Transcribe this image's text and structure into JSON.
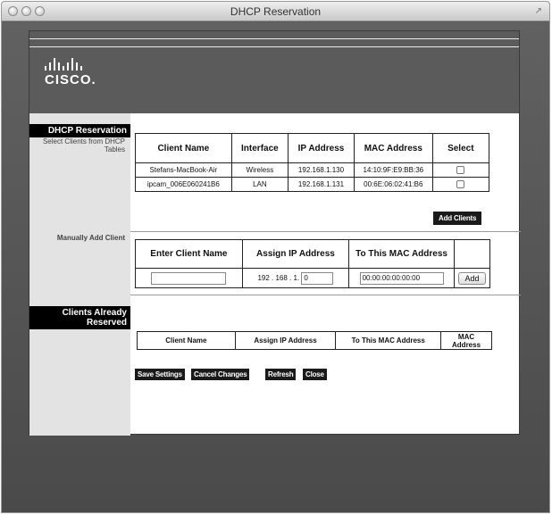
{
  "window": {
    "title": "DHCP Reservation"
  },
  "brand": {
    "logo_text": "CISCO."
  },
  "sections": {
    "dhcp_reservation": "DHCP Reservation",
    "select_clients_label": "Select Clients from DHCP Tables",
    "manually_add_label": "Manually Add Client",
    "clients_reserved": "Clients Already Reserved"
  },
  "clients_table": {
    "headers": [
      "Client Name",
      "Interface",
      "IP Address",
      "MAC Address",
      "Select"
    ],
    "rows": [
      {
        "name": "Stefans-MacBook-Air",
        "interface": "Wireless",
        "ip": "192.168.1.130",
        "mac": "14:10:9F:E9:BB:36"
      },
      {
        "name": "ipcam_006E060241B6",
        "interface": "LAN",
        "ip": "192.168.1.131",
        "mac": "00:6E:06:02:41:B6"
      }
    ]
  },
  "add_clients_button": "Add Clients",
  "manual_table": {
    "headers": [
      "Enter Client Name",
      "Assign IP Address",
      "To This MAC Address",
      ""
    ],
    "client_name_value": "",
    "ip_prefix": "192 . 168 . 1.",
    "ip_last_octet": "0",
    "mac_value": "00:00:00:00:00:00",
    "add_button": "Add"
  },
  "reserved_table": {
    "headers": [
      "Client Name",
      "Assign IP Address",
      "To This MAC Address",
      "MAC Address"
    ]
  },
  "actions": {
    "save": "Save Settings",
    "cancel": "Cancel Changes",
    "refresh": "Refresh",
    "close": "Close"
  },
  "colors": {
    "header_bg": "#5b5b5b",
    "page_bg": "#555555",
    "sidebar_bg": "#e3e3e3",
    "button_bg": "#1a1a1a"
  },
  "icons": {
    "window_controls": [
      "close-icon",
      "minimize-icon",
      "zoom-icon"
    ],
    "resize": "fullscreen-icon"
  }
}
